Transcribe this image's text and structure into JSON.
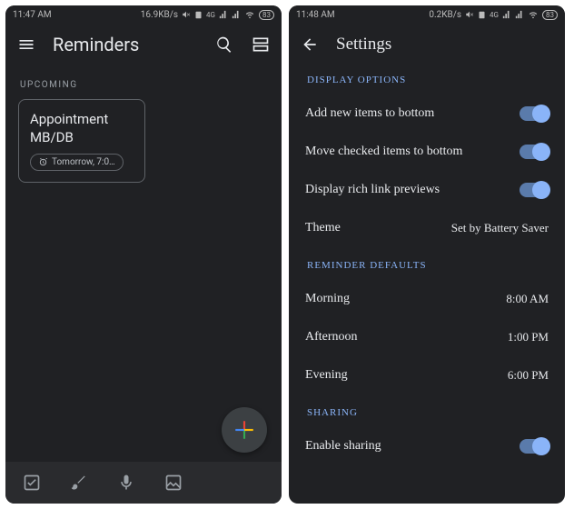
{
  "left": {
    "statusbar": {
      "time": "11:47 AM",
      "net": "16.9KB/s",
      "battery": "83"
    },
    "title": "Reminders",
    "section_upcoming": "UPCOMING",
    "card": {
      "title": "Appointment MB/DB",
      "chip": "Tomorrow, 7:0…"
    }
  },
  "right": {
    "statusbar": {
      "time": "11:48 AM",
      "net": "0.2KB/s",
      "battery": "83"
    },
    "title": "Settings",
    "sections": {
      "display": "DISPLAY OPTIONS",
      "defaults": "REMINDER DEFAULTS",
      "sharing": "SHARING"
    },
    "rows": {
      "add_bottom": "Add new items to bottom",
      "move_checked": "Move checked items to bottom",
      "rich_link": "Display rich link previews",
      "theme_label": "Theme",
      "theme_value": "Set by Battery Saver",
      "morning_label": "Morning",
      "morning_value": "8:00 AM",
      "afternoon_label": "Afternoon",
      "afternoon_value": "1:00 PM",
      "evening_label": "Evening",
      "evening_value": "6:00 PM",
      "enable_sharing": "Enable sharing"
    }
  }
}
